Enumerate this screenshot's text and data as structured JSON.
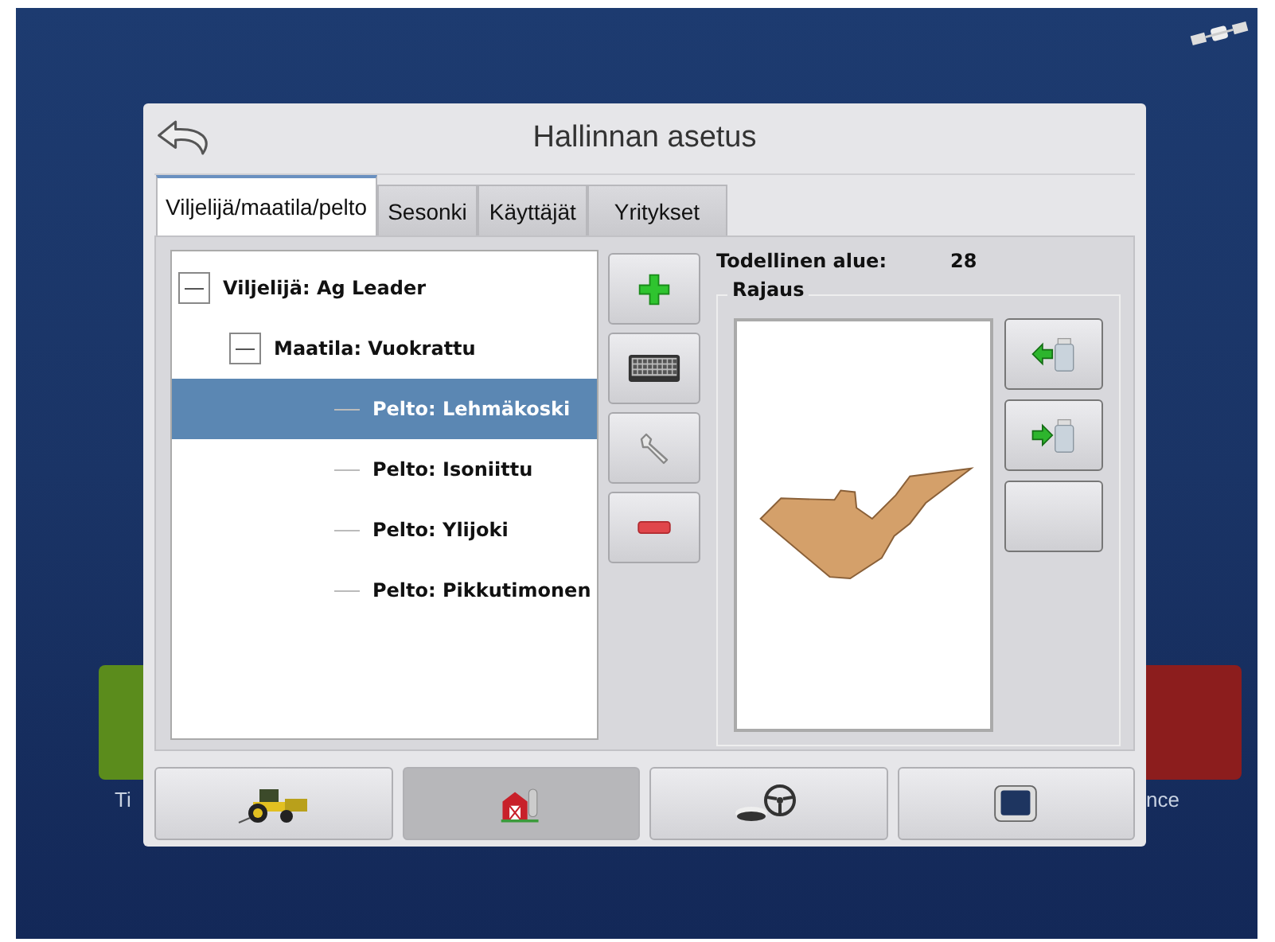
{
  "background_apps": [
    {
      "label": "Ti",
      "color": "#5b8c1c"
    },
    {
      "label": "nce",
      "color": "#8c1d1d"
    }
  ],
  "window": {
    "title": "Hallinnan asetus"
  },
  "tabs": [
    {
      "label": "Viljelijä/maatila/pelto",
      "selected": true
    },
    {
      "label": "Sesonki",
      "selected": false
    },
    {
      "label": "Käyttäjät",
      "selected": false
    },
    {
      "label": "Yritykset",
      "selected": false
    }
  ],
  "tree": [
    {
      "label": "Viljelijä: Ag Leader",
      "expanded": true,
      "selected": false,
      "children": [
        {
          "label": "Maatila: Vuokrattu",
          "expanded": true,
          "selected": false,
          "children": [
            {
              "label": "Pelto: Lehmäkoski",
              "selected": true
            },
            {
              "label": "Pelto: Isoniittu",
              "selected": false
            },
            {
              "label": "Pelto: Ylijoki",
              "selected": false
            },
            {
              "label": "Pelto: Pikkutimonen",
              "selected": false
            }
          ]
        }
      ]
    }
  ],
  "area": {
    "label": "Todellinen alue:",
    "value": "28"
  },
  "boundary": {
    "title": "Rajaus"
  },
  "nav": [
    {
      "kind": "tractor",
      "selected": false
    },
    {
      "kind": "barn",
      "selected": true
    },
    {
      "kind": "guidance",
      "selected": false
    },
    {
      "kind": "display",
      "selected": false
    }
  ]
}
